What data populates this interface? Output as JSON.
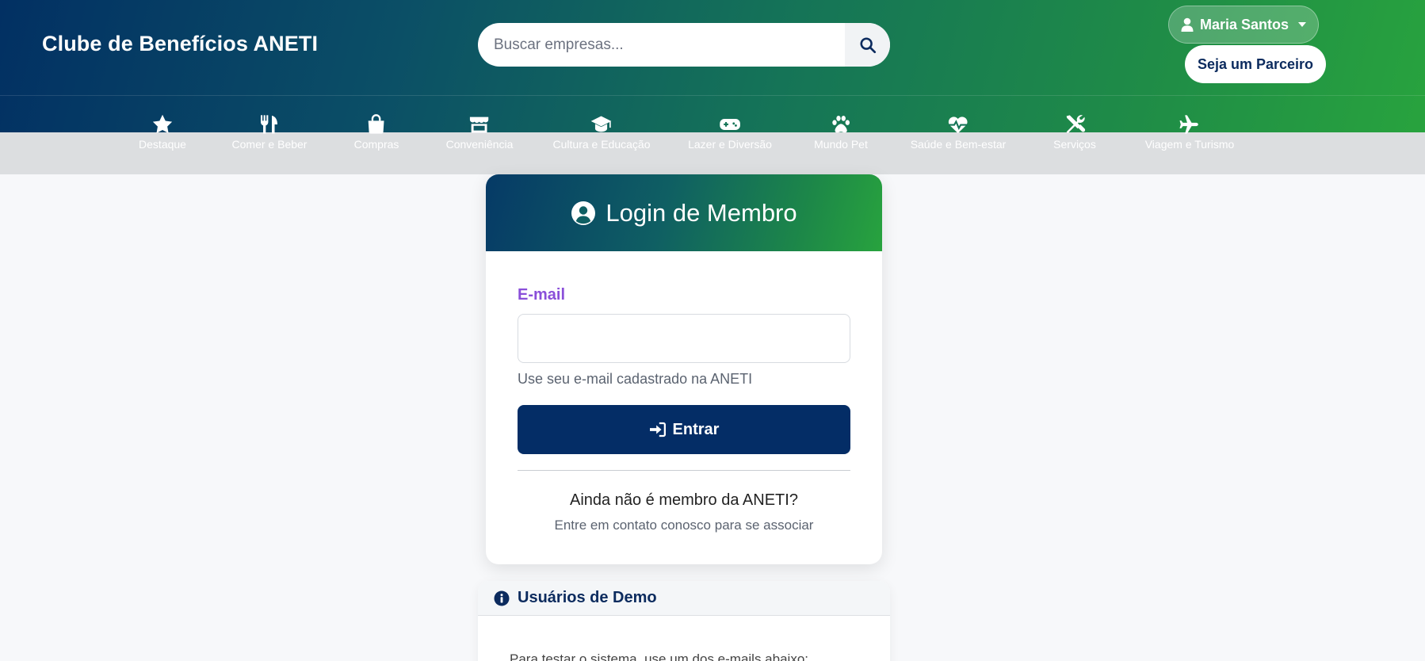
{
  "header": {
    "brand": "Clube de Benefícios ANETI",
    "search_placeholder": "Buscar empresas...",
    "user_name": "Maria Santos",
    "partner_label": "Seja um Parceiro"
  },
  "categories": [
    {
      "label": "Destaque",
      "icon": "star-icon"
    },
    {
      "label": "Comer e Beber",
      "icon": "utensils-icon"
    },
    {
      "label": "Compras",
      "icon": "shopping-bag-icon"
    },
    {
      "label": "Conveniência",
      "icon": "store-icon"
    },
    {
      "label": "Cultura e Educação",
      "icon": "graduation-cap-icon"
    },
    {
      "label": "Lazer e Diversão",
      "icon": "gamepad-icon"
    },
    {
      "label": "Mundo Pet",
      "icon": "paw-icon"
    },
    {
      "label": "Saúde e Bem-estar",
      "icon": "heart-pulse-icon"
    },
    {
      "label": "Serviços",
      "icon": "tools-icon"
    },
    {
      "label": "Viagem e Turismo",
      "icon": "plane-icon"
    }
  ],
  "login": {
    "title": "Login de Membro",
    "email_label": "E-mail",
    "email_value": "",
    "email_help": "Use seu e-mail cadastrado na ANETI",
    "submit_label": "Entrar",
    "not_member": "Ainda não é membro da ANETI?",
    "contact": "Entre em contato conosco para se associar"
  },
  "demo": {
    "title": "Usuários de Demo",
    "intro": "Para testar o sistema, use um dos e-mails abaixo:"
  },
  "colors": {
    "brand_navy": "#042d66",
    "brand_green": "#28a33e",
    "label_purple": "#8a4fd9"
  }
}
